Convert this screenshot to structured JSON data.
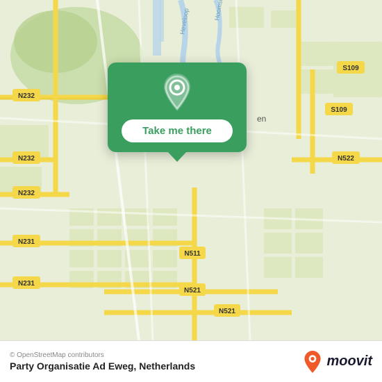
{
  "map": {
    "alt": "Map of Netherlands showing Party Organisatie Ad Eweg"
  },
  "popup": {
    "button_label": "Take me there"
  },
  "bottom_bar": {
    "copyright": "© OpenStreetMap contributors",
    "location_name": "Party Organisatie Ad Eweg, Netherlands"
  },
  "moovit": {
    "logo_text": "moovit"
  },
  "road_labels": {
    "n232_top": "N232",
    "n232_mid": "N232",
    "n232_bot": "N232",
    "n231_left": "N231",
    "n231_bot": "N231",
    "n511": "N511",
    "n521_mid": "N521",
    "n521_bot": "N521",
    "s109_top": "S109",
    "s109_mid": "S109",
    "n522": "N522",
    "hoomslo": "Hoomslo",
    "hevelo": "Heveloop"
  }
}
